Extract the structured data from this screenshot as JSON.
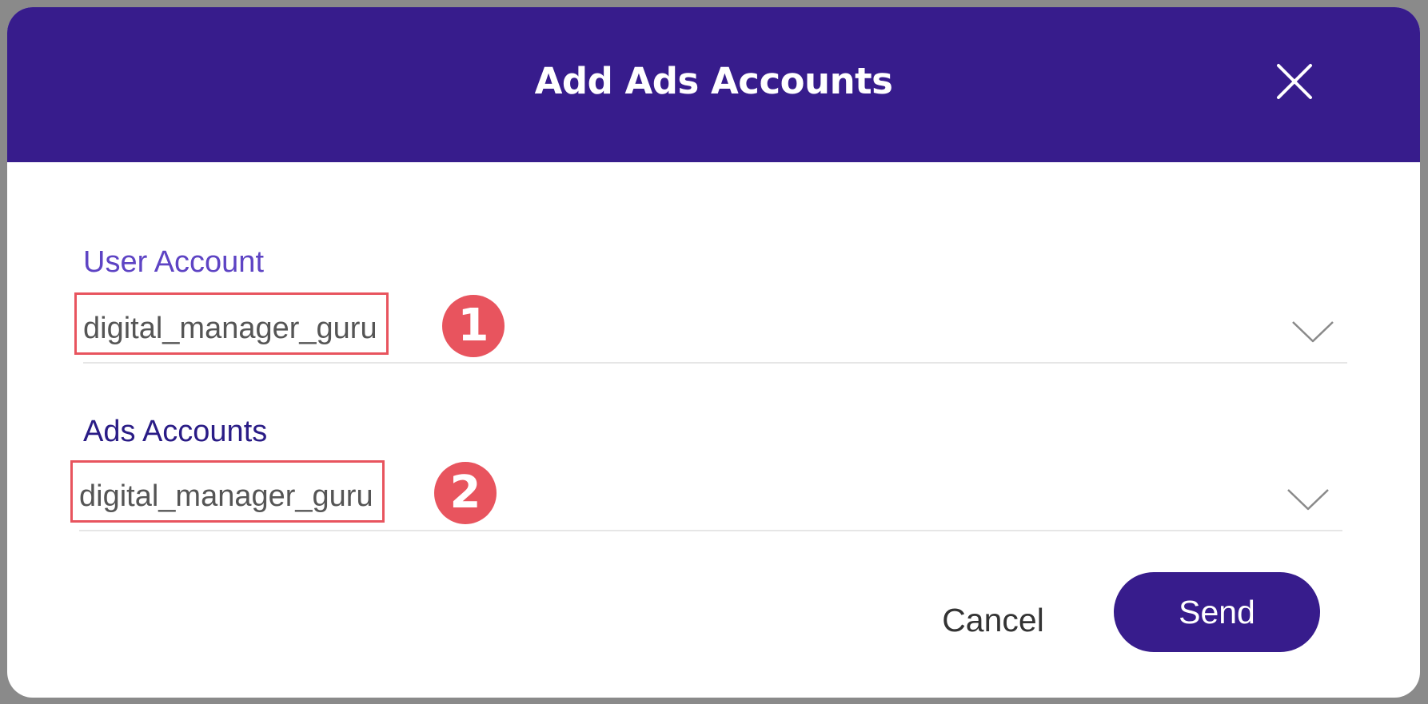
{
  "dialog": {
    "title": "Add Ads Accounts",
    "close_icon": "close-icon"
  },
  "fields": {
    "user_account": {
      "label": "User Account",
      "value": "digital_manager_guru",
      "dropdown_icon": "chevron-down-icon"
    },
    "ads_accounts": {
      "label": "Ads Accounts",
      "value": "digital_manager_guru",
      "dropdown_icon": "chevron-down-icon"
    }
  },
  "annotations": {
    "badge_1": "1",
    "badge_2": "2",
    "highlight_color": "#e8545e"
  },
  "actions": {
    "cancel_label": "Cancel",
    "send_label": "Send"
  },
  "colors": {
    "header_bg": "#371c8c",
    "primary_button": "#371c8c",
    "label_user": "#5e44c4",
    "label_ads": "#2a1c86"
  }
}
